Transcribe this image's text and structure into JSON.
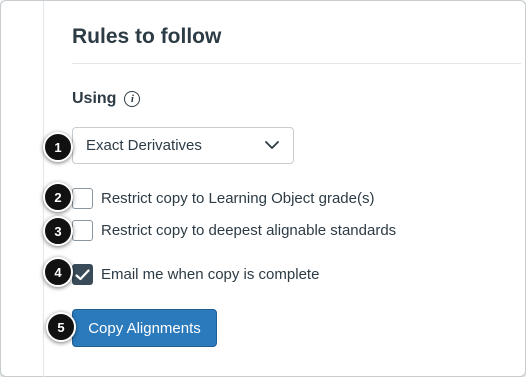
{
  "section": {
    "title": "Rules to follow"
  },
  "using": {
    "label": "Using",
    "info_icon": "info-icon"
  },
  "dropdown": {
    "selected": "Exact Derivatives"
  },
  "options": [
    {
      "label": "Restrict copy to Learning Object grade(s)",
      "checked": false
    },
    {
      "label": "Restrict copy to deepest alignable standards",
      "checked": false
    },
    {
      "label": "Email me when copy is complete",
      "checked": true
    }
  ],
  "action": {
    "copy_label": "Copy Alignments"
  },
  "steps": [
    "1",
    "2",
    "3",
    "4",
    "5"
  ],
  "colors": {
    "primary": "#2b7abc",
    "text": "#2d3b45",
    "checked_box": "#394b58",
    "step_badge": "#111111"
  }
}
